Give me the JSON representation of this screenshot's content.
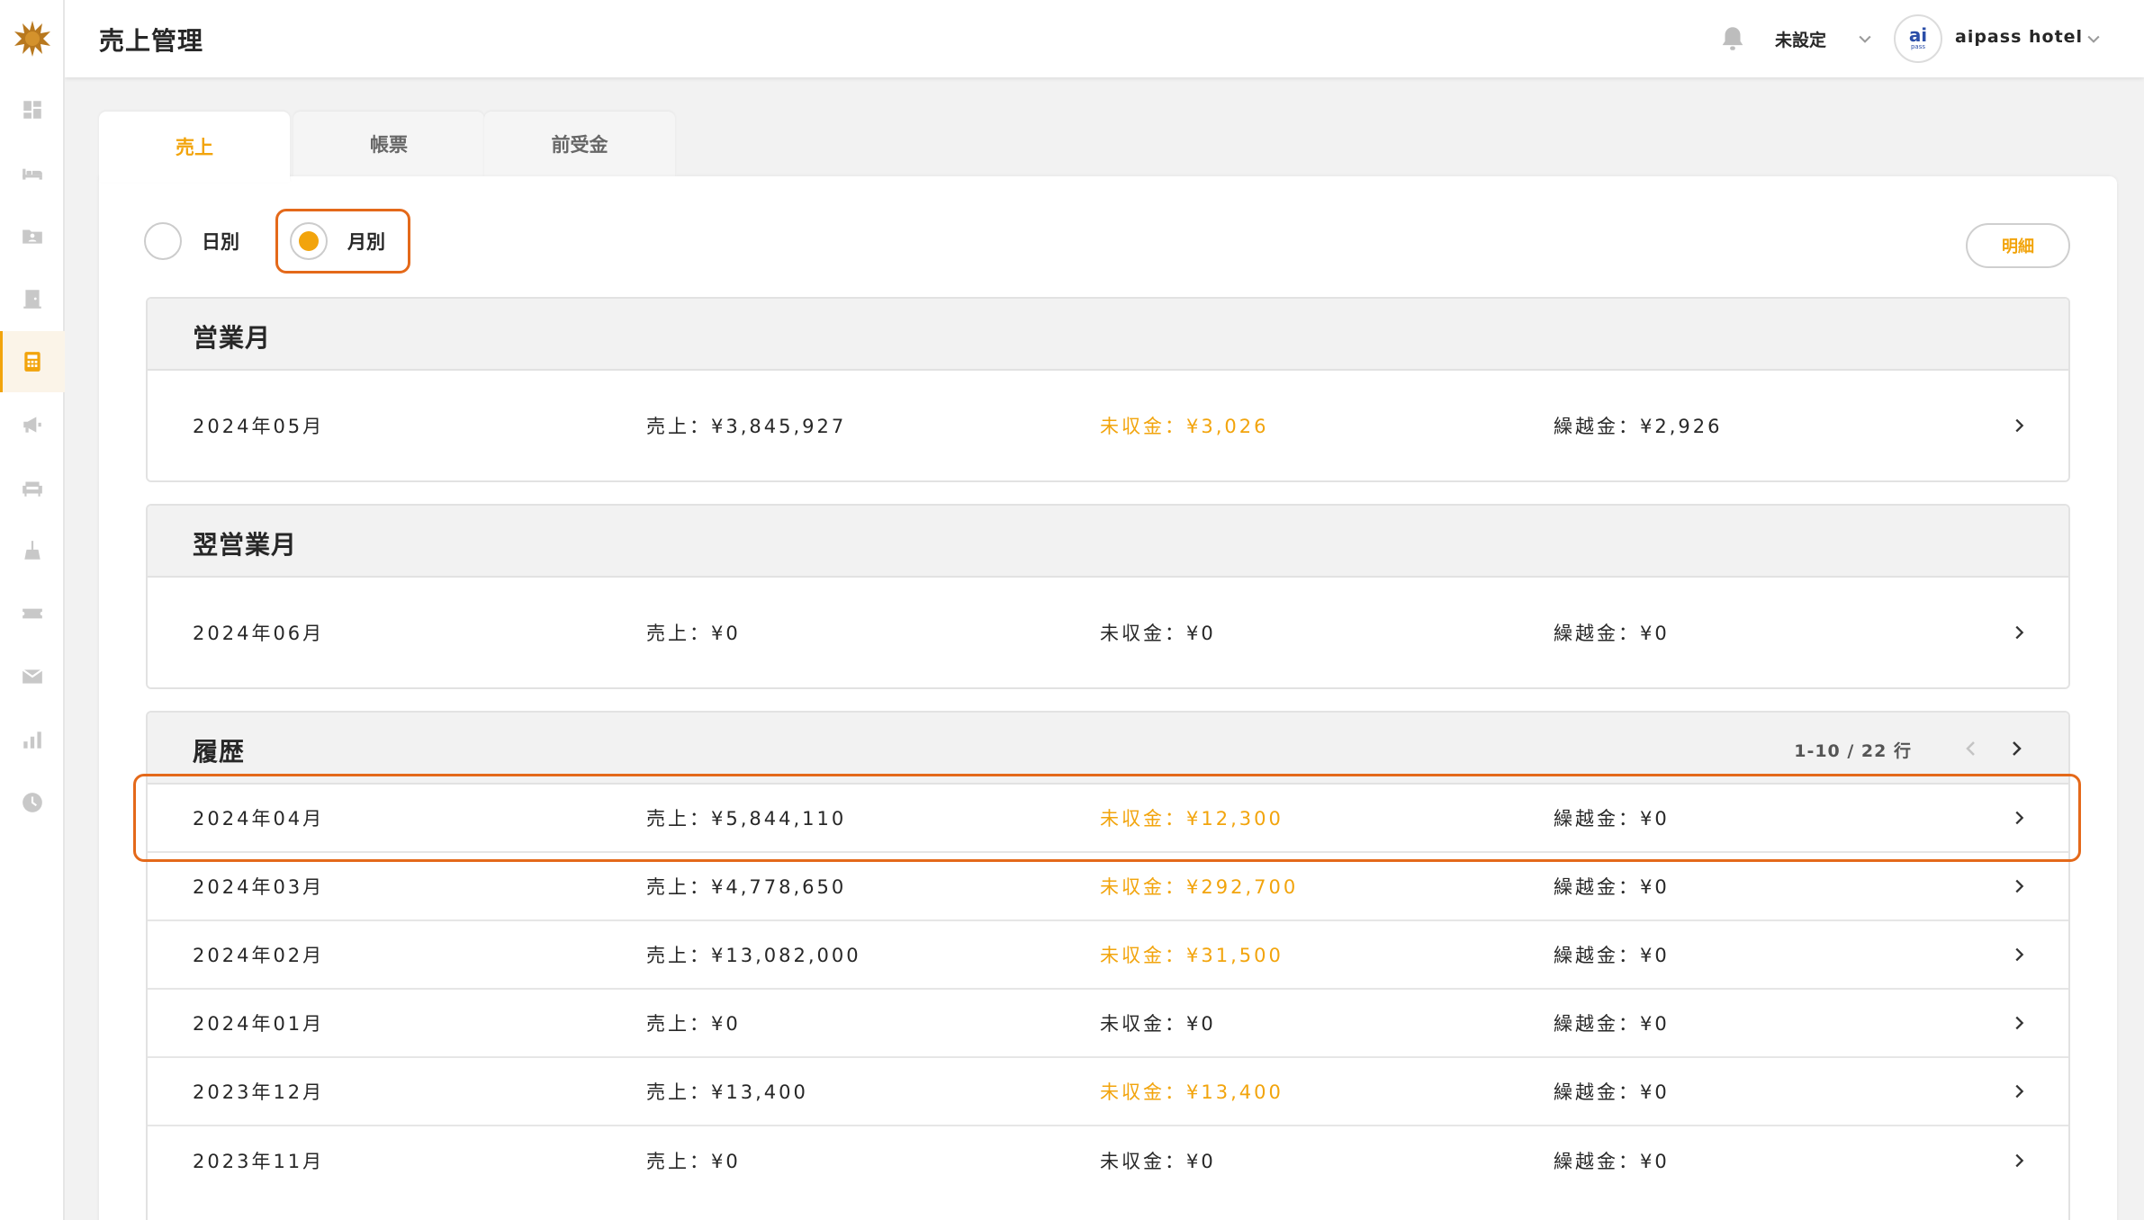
{
  "header": {
    "title": "売上管理",
    "facility": "未設定",
    "avatar_main": "ai",
    "avatar_sub": "pass",
    "hotel": "aipass hotel"
  },
  "sidebar": {
    "items": [
      {
        "icon": "dashboard-icon"
      },
      {
        "icon": "bed-icon"
      },
      {
        "icon": "guest-folder-icon"
      },
      {
        "icon": "door-icon"
      },
      {
        "icon": "calculator-icon",
        "active": true
      },
      {
        "icon": "megaphone-icon"
      },
      {
        "icon": "sofa-icon"
      },
      {
        "icon": "cleaning-icon"
      },
      {
        "icon": "ticket-icon"
      },
      {
        "icon": "mail-icon"
      },
      {
        "icon": "bar-chart-icon"
      },
      {
        "icon": "clock-icon"
      }
    ]
  },
  "tabs": [
    {
      "label": "売上",
      "active": true
    },
    {
      "label": "帳票"
    },
    {
      "label": "前受金"
    }
  ],
  "view_toggle": {
    "daily": "日別",
    "monthly": "月別",
    "selected": "monthly"
  },
  "detail_button": "明細",
  "current": {
    "title": "営業月",
    "row": {
      "month": "2024年05月",
      "sales": "売上：¥3,845,927",
      "unpaid": "未収金：¥3,026",
      "carry": "繰越金：¥2,926",
      "unpaid_alert": true
    }
  },
  "next": {
    "title": "翌営業月",
    "row": {
      "month": "2024年06月",
      "sales": "売上：¥0",
      "unpaid": "未収金：¥0",
      "carry": "繰越金：¥0",
      "unpaid_alert": false
    }
  },
  "history": {
    "title": "履歴",
    "pagination": "1-10 / 22 行",
    "rows": [
      {
        "month": "2024年04月",
        "sales": "売上：¥5,844,110",
        "unpaid": "未収金：¥12,300",
        "carry": "繰越金：¥0",
        "unpaid_alert": true
      },
      {
        "month": "2024年03月",
        "sales": "売上：¥4,778,650",
        "unpaid": "未収金：¥292,700",
        "carry": "繰越金：¥0",
        "unpaid_alert": true
      },
      {
        "month": "2024年02月",
        "sales": "売上：¥13,082,000",
        "unpaid": "未収金：¥31,500",
        "carry": "繰越金：¥0",
        "unpaid_alert": true
      },
      {
        "month": "2024年01月",
        "sales": "売上：¥0",
        "unpaid": "未収金：¥0",
        "carry": "繰越金：¥0",
        "unpaid_alert": false
      },
      {
        "month": "2023年12月",
        "sales": "売上：¥13,400",
        "unpaid": "未収金：¥13,400",
        "carry": "繰越金：¥0",
        "unpaid_alert": true
      },
      {
        "month": "2023年11月",
        "sales": "売上：¥0",
        "unpaid": "未収金：¥0",
        "carry": "繰越金：¥0",
        "unpaid_alert": false
      }
    ]
  },
  "colors": {
    "accent": "#f2a40c",
    "highlight": "#e4691a",
    "text": "#272727"
  }
}
